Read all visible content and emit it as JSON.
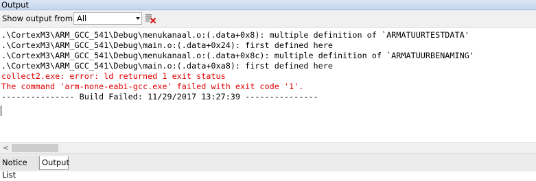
{
  "panel": {
    "title": "Output"
  },
  "toolbar": {
    "show_output_label": "Show output from:",
    "source_select": {
      "value": "All"
    },
    "clear_button_icon": "clear-all-icon"
  },
  "output": {
    "lines": [
      {
        "text": ".\\CortexM3\\ARM_GCC_541\\Debug\\menukanaal.o:(.data+0x8): multiple definition of `ARMATUURTESTDATA'",
        "color": "#000000"
      },
      {
        "text": ".\\CortexM3\\ARM_GCC_541\\Debug\\main.o:(.data+0x24): first defined here",
        "color": "#000000"
      },
      {
        "text": ".\\CortexM3\\ARM_GCC_541\\Debug\\menukanaal.o:(.data+0x8c): multiple definition of `ARMATUURBENAMING'",
        "color": "#000000"
      },
      {
        "text": ".\\CortexM3\\ARM_GCC_541\\Debug\\main.o:(.data+0xa8): first defined here",
        "color": "#000000"
      },
      {
        "text": "collect2.exe: error: ld returned 1 exit status",
        "color": "#e00000"
      },
      {
        "text": "The command 'arm-none-eabi-gcc.exe' failed with exit code '1'.",
        "color": "#e00000"
      },
      {
        "text": "--------------- Build Failed: 11/29/2017 13:27:39 ---------------",
        "color": "#000000"
      }
    ]
  },
  "scrollbar": {
    "left_arrow": "<"
  },
  "tabs": [
    {
      "label": "Notice List",
      "active": false
    },
    {
      "label": "Output",
      "active": true
    }
  ]
}
